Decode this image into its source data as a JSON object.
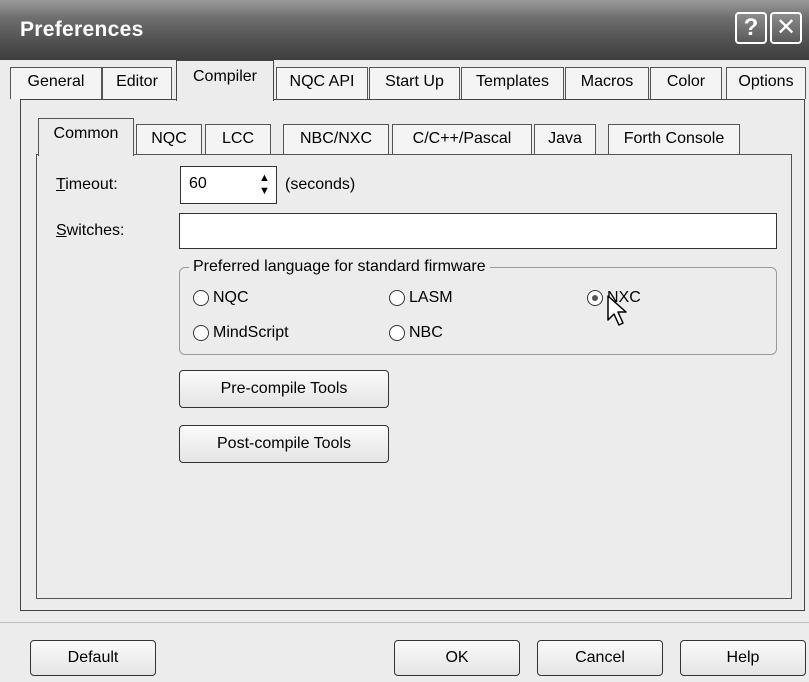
{
  "window": {
    "title": "Preferences",
    "help_glyph": "?",
    "close_glyph": "✕"
  },
  "top_tabs": [
    {
      "label": "General"
    },
    {
      "label": "Editor"
    },
    {
      "label": "Compiler",
      "selected": true
    },
    {
      "label": "NQC API"
    },
    {
      "label": "Start Up"
    },
    {
      "label": "Templates"
    },
    {
      "label": "Macros"
    },
    {
      "label": "Color"
    },
    {
      "label": "Options"
    }
  ],
  "sub_tabs": [
    {
      "label": "Common",
      "selected": true
    },
    {
      "label": "NQC"
    },
    {
      "label": "LCC"
    },
    {
      "label": "NBC/NXC"
    },
    {
      "label": "C/C++/Pascal"
    },
    {
      "label": "Java"
    },
    {
      "label": "Forth Console"
    }
  ],
  "common": {
    "timeout": {
      "label_ul": "T",
      "label_rest": "imeout:",
      "value": "60",
      "units": "(seconds)"
    },
    "switches": {
      "label_ul": "S",
      "label_rest": "witches:",
      "value": ""
    },
    "preferred_language": {
      "legend": "Preferred language for standard firmware",
      "options": [
        {
          "label": "NQC",
          "checked": false
        },
        {
          "label": "LASM",
          "checked": false
        },
        {
          "label": "NXC",
          "checked": true
        },
        {
          "label": "MindScript",
          "checked": false
        },
        {
          "label": "NBC",
          "checked": false
        }
      ]
    },
    "precompile_label": "Pre-compile Tools",
    "postcompile_label": "Post-compile Tools"
  },
  "footer": {
    "default_label": "Default",
    "ok_label": "OK",
    "cancel_label": "Cancel",
    "help_label": "Help"
  },
  "icons": {
    "spin_up": "▲",
    "spin_down": "▼",
    "cursor": "mouse-pointer-icon"
  }
}
